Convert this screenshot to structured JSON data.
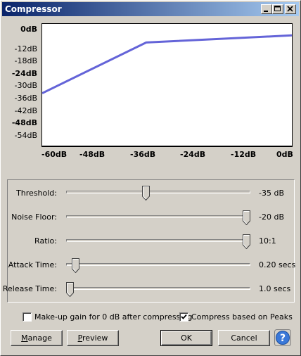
{
  "window": {
    "title": "Compressor"
  },
  "title_controls": [
    "minimize-icon",
    "maximize-icon",
    "close-icon"
  ],
  "graph": {
    "y_labels": [
      "0dB",
      "-12dB",
      "-18dB",
      "-24dB",
      "-30dB",
      "-36dB",
      "-42dB",
      "-48dB",
      "-54dB"
    ],
    "x_labels": [
      "-60dB",
      "-48dB",
      "-36dB",
      "-24dB",
      "-12dB",
      "0dB"
    ],
    "curve_color": "#6464d8",
    "threshold_db": -35,
    "ratio": 10
  },
  "controls": {
    "threshold": {
      "label": "Threshold:",
      "value": "-35 dB",
      "position": 0.43
    },
    "noise_floor": {
      "label": "Noise Floor:",
      "value": "-20 dB",
      "position": 1.0
    },
    "ratio": {
      "label": "Ratio:",
      "value": "10:1",
      "position": 1.0
    },
    "attack_time": {
      "label": "Attack Time:",
      "value": "0.20 secs",
      "position": 0.03
    },
    "release_time": {
      "label": "Release Time:",
      "value": "1.0 secs",
      "position": 0.0
    }
  },
  "options": {
    "makeup_gain": {
      "label": "Make-up gain for 0 dB after compressing",
      "checked": false
    },
    "compress_peaks": {
      "label": "Compress based on Peaks",
      "checked": true
    }
  },
  "buttons": {
    "manage_pre": "",
    "manage_u": "M",
    "manage_post": "anage",
    "preview_pre": "",
    "preview_u": "P",
    "preview_post": "review",
    "ok": "OK",
    "cancel": "Cancel",
    "help": "?"
  }
}
